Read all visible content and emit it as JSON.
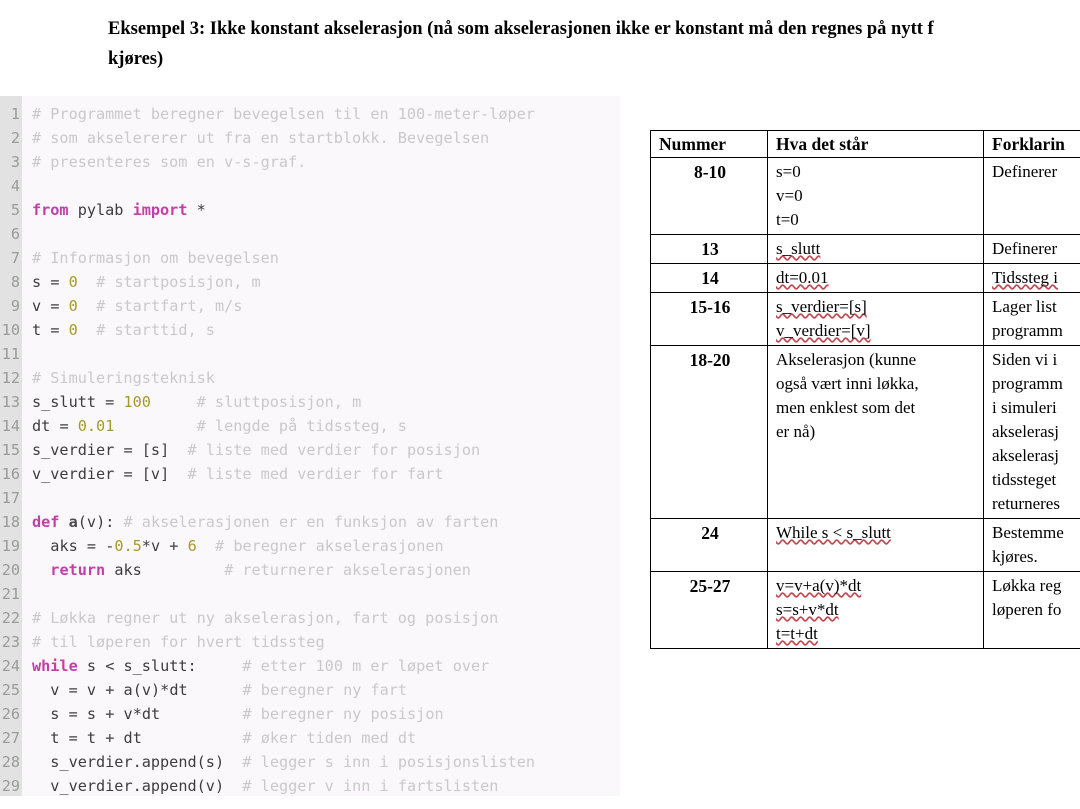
{
  "heading": {
    "line1": "Eksempel 3: Ikke konstant akselerasjon (nå som akselerasjonen ikke er konstant må den regnes på nytt f",
    "line2": "kjøres)"
  },
  "code": {
    "language": "python",
    "first_line_number": 1,
    "line_numbers": [
      "1",
      "2",
      "3",
      "4",
      "5",
      "6",
      "7",
      "8",
      "9",
      "10",
      "11",
      "12",
      "13",
      "14",
      "15",
      "16",
      "17",
      "18",
      "19",
      "20",
      "21",
      "22",
      "23",
      "24",
      "25",
      "26",
      "27",
      "28",
      "29"
    ],
    "lines": [
      "# Programmet beregner bevegelsen til en 100-meter-løper",
      "# som akselererer ut fra en startblokk. Bevegelsen",
      "# presenteres som en v-s-graf.",
      "",
      "from pylab import *",
      "",
      "# Informasjon om bevegelsen",
      "s = 0  # startposisjon, m",
      "v = 0  # startfart, m/s",
      "t = 0  # starttid, s",
      "",
      "# Simuleringsteknisk",
      "s_slutt = 100     # sluttposisjon, m",
      "dt = 0.01         # lengde på tidssteg, s",
      "s_verdier = [s]  # liste med verdier for posisjon",
      "v_verdier = [v]  # liste med verdier for fart",
      "",
      "def a(v): # akselerasjonen er en funksjon av farten",
      "  aks = -0.5*v + 6  # beregner akselerasjonen",
      "  return aks         # returnerer akselerasjonen",
      "",
      "# Løkka regner ut ny akselerasjon, fart og posisjon",
      "# til løperen for hvert tidssteg",
      "while s < s_slutt:     # etter 100 m er løpet over",
      "  v = v + a(v)*dt      # beregner ny fart",
      "  s = s + v*dt         # beregner ny posisjon",
      "  t = t + dt           # øker tiden med dt",
      "  s_verdier.append(s)  # legger s inn i posisjonslisten",
      "  v_verdier.append(v)  # legger v inn i fartslisten"
    ],
    "colors": {
      "background": "#fbf8fb",
      "gutter_background": "#e2e2e2",
      "gutter_text": "#9a9a9a",
      "comment": "#c9c9c9",
      "keyword": "#c13fa8",
      "number": "#a39a28",
      "plain": "#3d3d3d"
    }
  },
  "table": {
    "headers": [
      "Nummer",
      "Hva det står",
      "Forklarin"
    ],
    "rows": [
      {
        "nummer": "8-10",
        "hva": [
          "s=0",
          "v=0",
          "t=0"
        ],
        "forklaring": [
          "Definerer "
        ]
      },
      {
        "nummer": "13",
        "hva": [
          "s_slutt"
        ],
        "forklaring": [
          "Definerer "
        ]
      },
      {
        "nummer": "14",
        "hva": [
          "dt=0.01"
        ],
        "forklaring": [
          "Tidssteg i"
        ]
      },
      {
        "nummer": "15-16",
        "hva": [
          "s_verdier=[s]",
          "v_verdier=[v]"
        ],
        "forklaring": [
          "Lager list",
          "programm"
        ]
      },
      {
        "nummer": "18-20",
        "hva": [
          "Akselerasjon (kunne",
          "også vært inni løkka,",
          "men enklest som det",
          "er nå)"
        ],
        "forklaring": [
          "Siden vi i",
          "programm",
          "i simuleri",
          "akselerasj",
          "akselerasj",
          "tidssteget",
          "returneres"
        ]
      },
      {
        "nummer": "24",
        "hva": [
          "While s < s_slutt"
        ],
        "forklaring": [
          "Bestemme",
          "kjøres."
        ]
      },
      {
        "nummer": "25-27",
        "hva": [
          "v=v+a(v)*dt",
          "s=s+v*dt",
          "t=t+dt"
        ],
        "forklaring": [
          "Løkka reg",
          "løperen fo"
        ]
      }
    ],
    "spellcheck_color": "#c14a52"
  }
}
